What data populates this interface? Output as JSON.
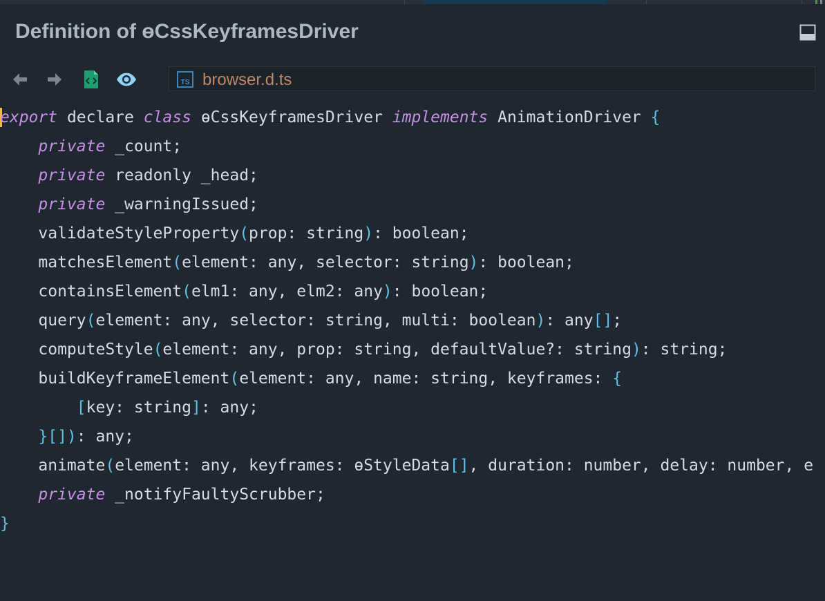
{
  "window": {
    "title": "Definition of ɵCssKeyframesDriver"
  },
  "toolbar": {
    "back": "back-arrow-icon",
    "forward": "forward-arrow-icon",
    "source": "source-file-icon",
    "preview": "eye-icon",
    "file_icon": "typescript-file-icon",
    "file_icon_text": "TS",
    "file_name": "browser.d.ts"
  },
  "colors": {
    "background": "#1f2830",
    "title": "#aeb8c1",
    "keyword": "#c68fe3",
    "punctuation": "#61c0e3",
    "text": "#d3dce3",
    "filename": "#c08665",
    "cursor": "#f2b84a",
    "toolbar_icon": "#7a8690",
    "source_icon": "#1f9e74",
    "eye_icon": "#8fd3f7"
  },
  "code": {
    "lines": [
      {
        "indent": "",
        "tokens": [
          [
            "kw",
            "export"
          ],
          [
            "tx",
            " declare "
          ],
          [
            "kw",
            "class"
          ],
          [
            "tx",
            " ɵCssKeyframesDriver "
          ],
          [
            "kw",
            "implements"
          ],
          [
            "tx",
            " AnimationDriver "
          ],
          [
            "pn",
            "{"
          ]
        ]
      },
      {
        "indent": "    ",
        "tokens": [
          [
            "kw",
            "private"
          ],
          [
            "tx",
            " _count;"
          ]
        ]
      },
      {
        "indent": "    ",
        "tokens": [
          [
            "kw",
            "private"
          ],
          [
            "tx",
            " readonly _head;"
          ]
        ]
      },
      {
        "indent": "    ",
        "tokens": [
          [
            "kw",
            "private"
          ],
          [
            "tx",
            " _warningIssued;"
          ]
        ]
      },
      {
        "indent": "    ",
        "tokens": [
          [
            "tx",
            "validateStyleProperty"
          ],
          [
            "pn",
            "("
          ],
          [
            "tx",
            "prop: string"
          ],
          [
            "pn",
            ")"
          ],
          [
            "tx",
            ": boolean;"
          ]
        ]
      },
      {
        "indent": "    ",
        "tokens": [
          [
            "tx",
            "matchesElement"
          ],
          [
            "pn",
            "("
          ],
          [
            "tx",
            "element: any, selector: string"
          ],
          [
            "pn",
            ")"
          ],
          [
            "tx",
            ": boolean;"
          ]
        ]
      },
      {
        "indent": "    ",
        "tokens": [
          [
            "tx",
            "containsElement"
          ],
          [
            "pn",
            "("
          ],
          [
            "tx",
            "elm1: any, elm2: any"
          ],
          [
            "pn",
            ")"
          ],
          [
            "tx",
            ": boolean;"
          ]
        ]
      },
      {
        "indent": "    ",
        "tokens": [
          [
            "tx",
            "query"
          ],
          [
            "pn",
            "("
          ],
          [
            "tx",
            "element: any, selector: string, multi: boolean"
          ],
          [
            "pn",
            ")"
          ],
          [
            "tx",
            ": any"
          ],
          [
            "pn",
            "[]"
          ],
          [
            "tx",
            ";"
          ]
        ]
      },
      {
        "indent": "    ",
        "tokens": [
          [
            "tx",
            "computeStyle"
          ],
          [
            "pn",
            "("
          ],
          [
            "tx",
            "element: any, prop: string, defaultValue?: string"
          ],
          [
            "pn",
            ")"
          ],
          [
            "tx",
            ": string;"
          ]
        ]
      },
      {
        "indent": "    ",
        "tokens": [
          [
            "tx",
            "buildKeyframeElement"
          ],
          [
            "pn",
            "("
          ],
          [
            "tx",
            "element: any, name: string, keyframes: "
          ],
          [
            "pn",
            "{"
          ]
        ]
      },
      {
        "indent": "        ",
        "tokens": [
          [
            "pn",
            "["
          ],
          [
            "tx",
            "key: string"
          ],
          [
            "pn",
            "]"
          ],
          [
            "tx",
            ": any;"
          ]
        ]
      },
      {
        "indent": "    ",
        "tokens": [
          [
            "pn",
            "}[])"
          ],
          [
            "tx",
            ": any;"
          ]
        ]
      },
      {
        "indent": "    ",
        "tokens": [
          [
            "tx",
            "animate"
          ],
          [
            "pn",
            "("
          ],
          [
            "tx",
            "element: any, keyframes: ɵStyleData"
          ],
          [
            "pn",
            "[]"
          ],
          [
            "tx",
            ", duration: number, delay: number, e"
          ]
        ]
      },
      {
        "indent": "    ",
        "tokens": [
          [
            "kw",
            "private"
          ],
          [
            "tx",
            " _notifyFaultyScrubber;"
          ]
        ]
      },
      {
        "indent": "",
        "tokens": [
          [
            "pn",
            "}"
          ]
        ]
      }
    ]
  }
}
